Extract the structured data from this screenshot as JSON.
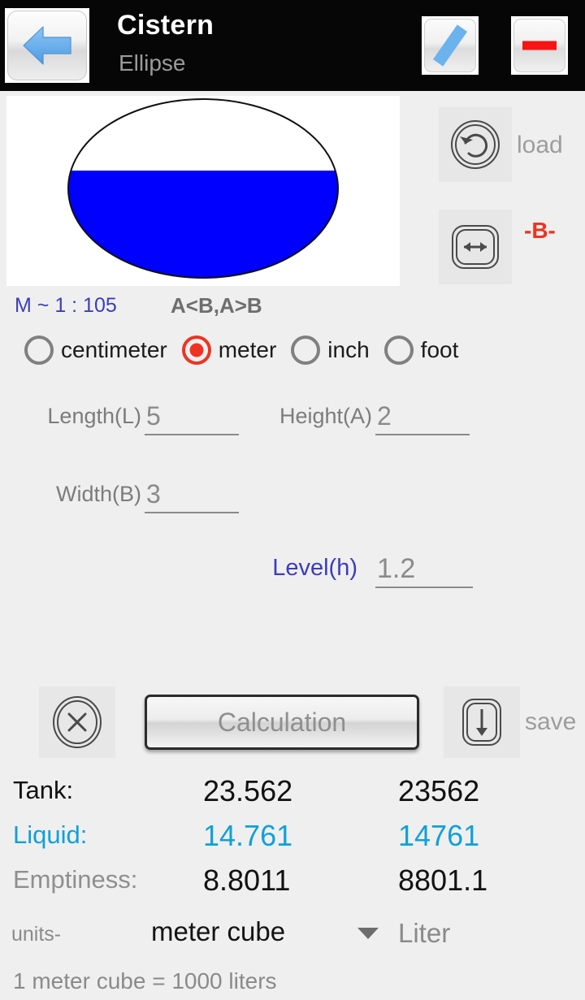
{
  "titlebar": {
    "title": "Cistern",
    "subtitle": "Ellipse",
    "back_icon": "back-arrow-icon",
    "pencil_icon": "pencil-icon",
    "minus_icon": "minus-icon"
  },
  "tools": {
    "load_label": "load",
    "load_icon": "reload-icon",
    "width_icon": "horizontal-resize-icon",
    "width_marker": "-B-"
  },
  "scale": {
    "text": "M ~ 1 : 105",
    "constraint": "A<B,A>B"
  },
  "units_radio": {
    "selected": "meter",
    "options": [
      {
        "id": "centimeter",
        "label": "centimeter",
        "selected": false
      },
      {
        "id": "meter",
        "label": "meter",
        "selected": true
      },
      {
        "id": "inch",
        "label": "inch",
        "selected": false
      },
      {
        "id": "foot",
        "label": "foot",
        "selected": false
      }
    ]
  },
  "fields": {
    "length": {
      "label": "Length(L)",
      "value": "5"
    },
    "height": {
      "label": "Height(A)",
      "value": "2"
    },
    "width": {
      "label": "Width(B)",
      "value": "3"
    },
    "level": {
      "label": "Level(h)",
      "value": "1.2"
    }
  },
  "actions": {
    "clear_icon": "clear-x-icon",
    "calculation_label": "Calculation",
    "save_icon": "save-download-icon",
    "save_label": "save"
  },
  "results": {
    "rows": [
      {
        "label": "Tank:",
        "col1": "23.562",
        "col2": "23562"
      },
      {
        "label": "Liquid:",
        "col1": "14.761",
        "col2": "14761"
      },
      {
        "label": "Emptiness:",
        "col1": "8.8011",
        "col2": "8801.1"
      }
    ]
  },
  "units_footer": {
    "prefix": "units-",
    "selected_unit": "meter cube",
    "second_unit": "Liter",
    "conversion": "1 meter cube = 1000 liters",
    "caret_icon": "chevron-down-icon"
  },
  "colors": {
    "accent_red": "#ee3322",
    "liquid_cyan": "#11a0d8",
    "scale_blue": "#3d3dbb",
    "tank_fill": "#0000ff",
    "titlebar_bg": "#060606"
  },
  "diagram": {
    "shape": "ellipse",
    "fill_ratio": 0.6,
    "fill_color": "#0000ff",
    "outline_color": "#111111"
  }
}
